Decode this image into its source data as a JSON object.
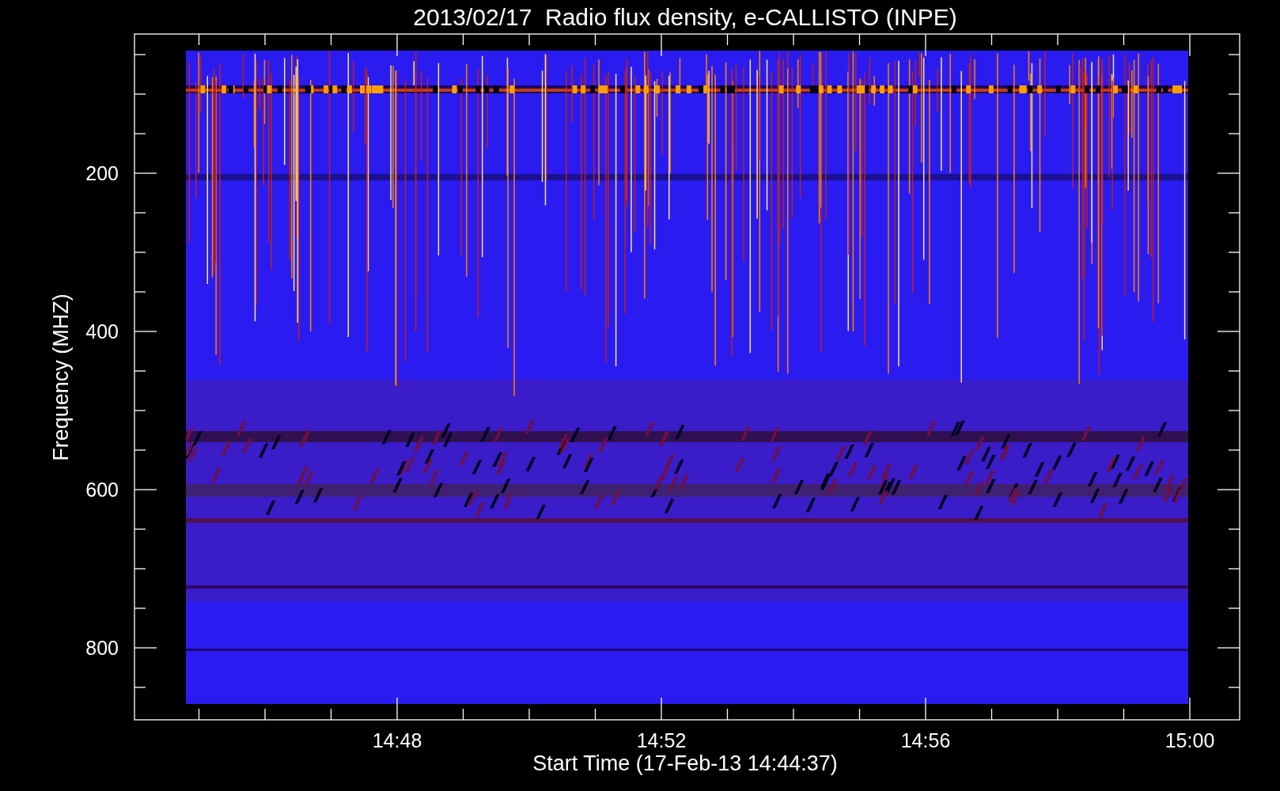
{
  "title": "2013/02/17  Radio flux density, e-CALLISTO (INPE)",
  "y_axis": {
    "label": "Frequency (MHZ)",
    "ticks": [
      "200",
      "400",
      "600",
      "800"
    ]
  },
  "x_axis": {
    "label": "Start Time (17-Feb-13 14:44:37)",
    "ticks": [
      "14:48",
      "14:52",
      "14:56",
      "15:00"
    ]
  }
}
